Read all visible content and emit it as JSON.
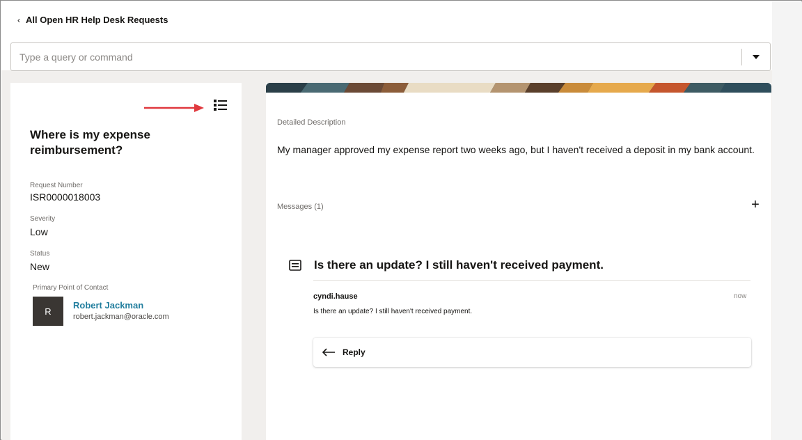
{
  "header": {
    "back_label": "All Open HR Help Desk Requests"
  },
  "command_bar": {
    "placeholder": "Type a query or command"
  },
  "request": {
    "title": "Where is my expense reimbursement?",
    "fields": [
      {
        "label": "Request Number",
        "value": "ISR0000018003"
      },
      {
        "label": "Severity",
        "value": "Low"
      },
      {
        "label": "Status",
        "value": "New"
      }
    ],
    "contact": {
      "label": "Primary Point of Contact",
      "initial": "R",
      "name": "Robert Jackman",
      "email": "robert.jackman@oracle.com"
    }
  },
  "detail": {
    "description_label": "Detailed Description",
    "description": "My manager approved my expense report two weeks ago, but I haven't received a deposit in my bank account.",
    "messages_label": "Messages (1)",
    "message": {
      "title": "Is there an update? I still haven't received payment.",
      "author": "cyndi.hause",
      "time": "now",
      "body": "Is there an update? I still haven't received payment.",
      "reply_label": "Reply"
    }
  },
  "colors": {
    "annotation_arrow": "#e0393e",
    "link": "#227e9e",
    "avatar_bg": "#3a3633"
  }
}
